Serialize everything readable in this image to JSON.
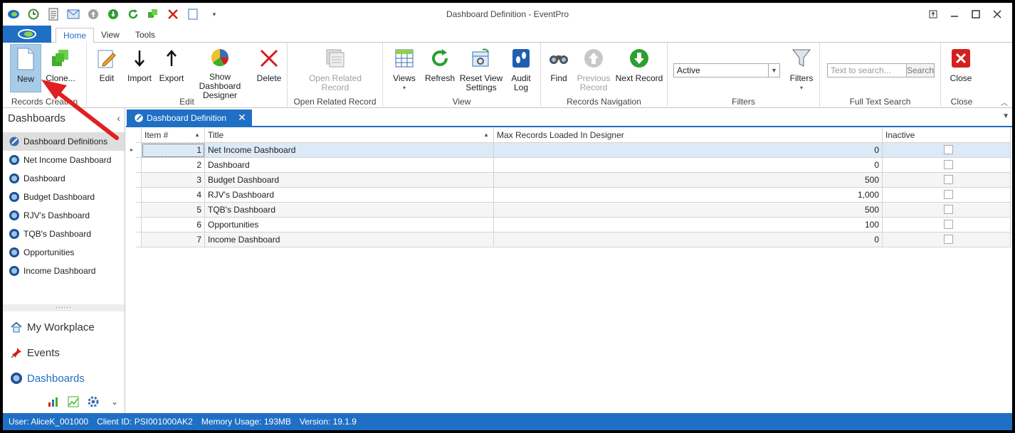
{
  "window": {
    "title": "Dashboard Definition - EventPro",
    "controls": [
      "pin-icon",
      "minimize-icon",
      "maximize-icon",
      "close-icon"
    ]
  },
  "quick_access": [
    "app-logo-icon",
    "clock-icon",
    "document-icon",
    "mail-icon",
    "up-arrow-icon",
    "down-arrow-icon",
    "refresh-icon",
    "add-icon",
    "delete-icon",
    "page-icon",
    "customize-dropdown-icon"
  ],
  "ribbon_tabs": [
    {
      "label": "Home",
      "active": true
    },
    {
      "label": "View",
      "active": false
    },
    {
      "label": "Tools",
      "active": false
    }
  ],
  "ribbon": {
    "groups": {
      "records_creation": "Records Creation",
      "edit": "Edit",
      "open_related": "Open Related Record",
      "view": "View",
      "records_navigation": "Records Navigation",
      "filters": "Filters",
      "full_text_search": "Full Text Search",
      "close": "Close"
    },
    "buttons": {
      "new": "New",
      "clone": "Clone...",
      "edit": "Edit",
      "import": "Import",
      "export": "Export",
      "show_designer_1": "Show Dashboard",
      "show_designer_2": "Designer",
      "delete": "Delete",
      "open_related_1": "Open Related",
      "open_related_2": "Record",
      "views": "Views",
      "refresh": "Refresh",
      "reset_view_1": "Reset View",
      "reset_view_2": "Settings",
      "audit_1": "Audit",
      "audit_2": "Log",
      "find": "Find",
      "previous_1": "Previous",
      "previous_2": "Record",
      "next_record": "Next Record",
      "filters": "Filters",
      "close": "Close"
    },
    "filter_value": "Active",
    "search_placeholder": "Text to search...",
    "search_button": "Search"
  },
  "navigation": {
    "header": "Dashboards",
    "items": [
      {
        "label": "Dashboard Definitions",
        "selected": true
      },
      {
        "label": "Net Income Dashboard"
      },
      {
        "label": "Dashboard"
      },
      {
        "label": "Budget Dashboard"
      },
      {
        "label": "RJV's Dashboard"
      },
      {
        "label": "TQB's Dashboard"
      },
      {
        "label": "Opportunities"
      },
      {
        "label": "Income Dashboard"
      }
    ],
    "splitter": "......",
    "workspaces": [
      {
        "label": "My Workplace"
      },
      {
        "label": "Events"
      },
      {
        "label": "Dashboards",
        "active": true
      }
    ]
  },
  "document_tab": {
    "label": "Dashboard Definition",
    "close": "✕"
  },
  "grid": {
    "columns": [
      "Item #",
      "Title",
      "Max Records Loaded In Designer",
      "Inactive"
    ],
    "rows": [
      {
        "item": "1",
        "title": "Net Income Dashboard",
        "max": "0",
        "inactive": false
      },
      {
        "item": "2",
        "title": "Dashboard",
        "max": "0",
        "inactive": false
      },
      {
        "item": "3",
        "title": "Budget Dashboard",
        "max": "500",
        "inactive": false
      },
      {
        "item": "4",
        "title": "RJV's Dashboard",
        "max": "1,000",
        "inactive": false
      },
      {
        "item": "5",
        "title": "TQB's Dashboard",
        "max": "500",
        "inactive": false
      },
      {
        "item": "6",
        "title": "Opportunities",
        "max": "100",
        "inactive": false
      },
      {
        "item": "7",
        "title": "Income Dashboard",
        "max": "0",
        "inactive": false
      }
    ]
  },
  "status": {
    "user": "User: AliceK_001000",
    "client": "Client ID: PSI001000AK2",
    "memory": "Memory Usage: 193MB",
    "version": "Version: 19.1.9"
  },
  "colors": {
    "accent": "#1f6fc5",
    "annotation": "#e02020",
    "selected_row": "#dce9f7"
  }
}
